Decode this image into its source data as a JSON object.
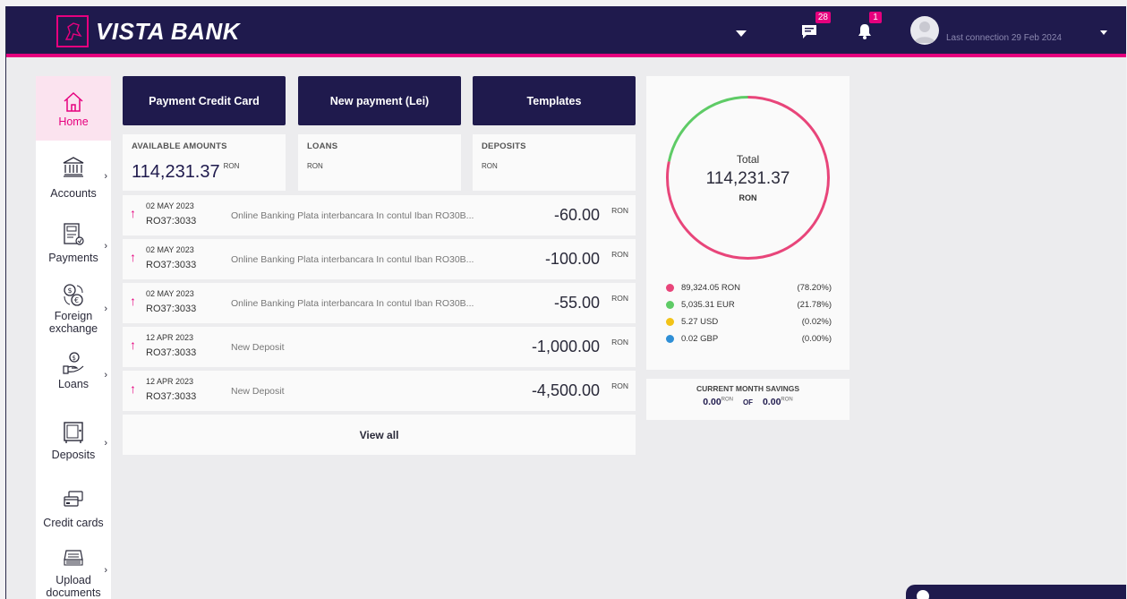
{
  "header": {
    "brand": "VISTA BANK",
    "messages_badge": "28",
    "notifications_badge": "1",
    "last_connection": "Last connection 29 Feb 2024"
  },
  "sidebar": {
    "items": [
      {
        "label": "Home",
        "icon": "home-icon"
      },
      {
        "label": "Accounts",
        "icon": "bank-icon"
      },
      {
        "label": "Payments",
        "icon": "payment-document-icon"
      },
      {
        "label": "Foreign exchange",
        "icon": "currency-exchange-icon"
      },
      {
        "label": "Loans",
        "icon": "loan-hand-icon"
      },
      {
        "label": "Deposits",
        "icon": "safe-icon"
      },
      {
        "label": "Credit cards",
        "icon": "credit-card-icon"
      },
      {
        "label": "Upload documents",
        "icon": "upload-tray-icon"
      }
    ]
  },
  "actions": {
    "payment_credit_card": "Payment Credit Card",
    "new_payment": "New payment (Lei)",
    "templates": "Templates"
  },
  "summary": {
    "available_title": "AVAILABLE AMOUNTS",
    "available_value": "114,231.37",
    "available_currency": "RON",
    "loans_title": "LOANS",
    "loans_currency": "RON",
    "deposits_title": "DEPOSITS",
    "deposits_currency": "RON"
  },
  "transactions": [
    {
      "date": "02 MAY 2023",
      "account": "RO37:3033",
      "description": "Online Banking Plata interbancara In contul Iban RO30B...",
      "amount": "-60.00",
      "currency": "RON"
    },
    {
      "date": "02 MAY 2023",
      "account": "RO37:3033",
      "description": "Online Banking Plata interbancara In contul Iban RO30B...",
      "amount": "-100.00",
      "currency": "RON"
    },
    {
      "date": "02 MAY 2023",
      "account": "RO37:3033",
      "description": "Online Banking Plata interbancara In contul Iban RO30B...",
      "amount": "-55.00",
      "currency": "RON"
    },
    {
      "date": "12 APR 2023",
      "account": "RO37:3033",
      "description": "New Deposit",
      "amount": "-1,000.00",
      "currency": "RON"
    },
    {
      "date": "12 APR 2023",
      "account": "RO37:3033",
      "description": "New Deposit",
      "amount": "-4,500.00",
      "currency": "RON"
    }
  ],
  "view_all": "View all",
  "total": {
    "label": "Total",
    "value": "114,231.37",
    "currency": "RON"
  },
  "breakdown": [
    {
      "value": "89,324.05 RON",
      "pct": "(78.20%)",
      "share": 0.782,
      "color": "#e8457a"
    },
    {
      "value": "5,035.31 EUR",
      "pct": "(21.78%)",
      "share": 0.2178,
      "color": "#5ecb66"
    },
    {
      "value": "5.27 USD",
      "pct": "(0.02%)",
      "share": 0.0002,
      "color": "#f2c318"
    },
    {
      "value": "0.02 GBP",
      "pct": "(0.00%)",
      "share": 0.0,
      "color": "#2f8fd6"
    }
  ],
  "savings": {
    "title": "CURRENT MONTH SAVINGS",
    "current": "0.00",
    "current_currency": "RON",
    "of": "OF",
    "target": "0.00",
    "target_currency": "RON"
  },
  "colors": {
    "navy": "#1f1a4d",
    "accent": "#e6007e"
  }
}
